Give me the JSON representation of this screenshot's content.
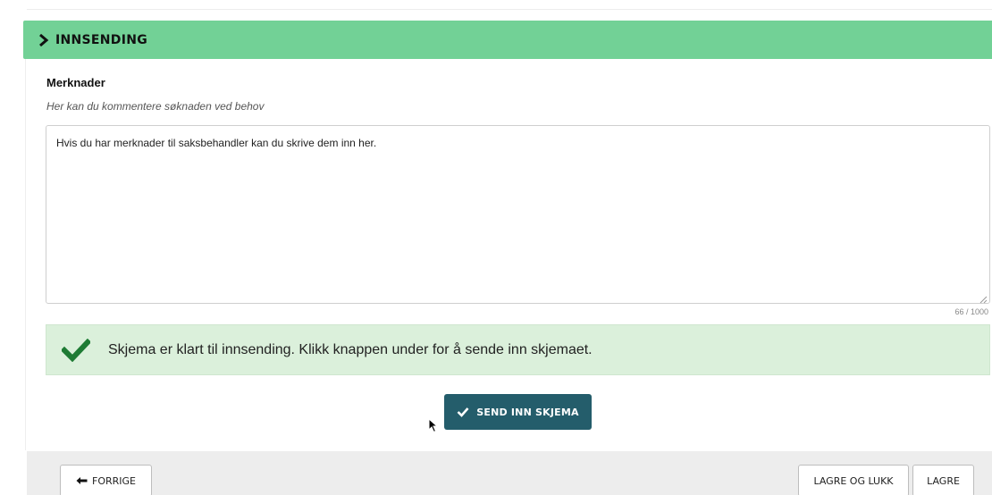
{
  "section": {
    "title": "INNSENDING"
  },
  "remarks": {
    "label": "Merknader",
    "help_text": "Her kan du kommentere søknaden ved behov",
    "value": "Hvis du har merknader til saksbehandler kan du skrive dem inn her.",
    "char_count": "66 / 1000"
  },
  "alert": {
    "message": "Skjema er klart til innsending. Klikk knappen under for å sende inn skjemaet."
  },
  "actions": {
    "submit_label": "SEND INN SKJEMA",
    "previous_label": "FORRIGE",
    "save_close_label": "LAGRE OG LUKK",
    "save_label": "LAGRE"
  },
  "colors": {
    "header_green": "#72d196",
    "alert_background": "#dbf0db",
    "check_green": "#1e7b34",
    "primary_button": "#245d6b"
  },
  "icons": {
    "section_toggle": "chevron-right-icon",
    "alert": "checkmark-icon",
    "submit": "checkmark-icon",
    "previous": "arrow-left-icon"
  }
}
